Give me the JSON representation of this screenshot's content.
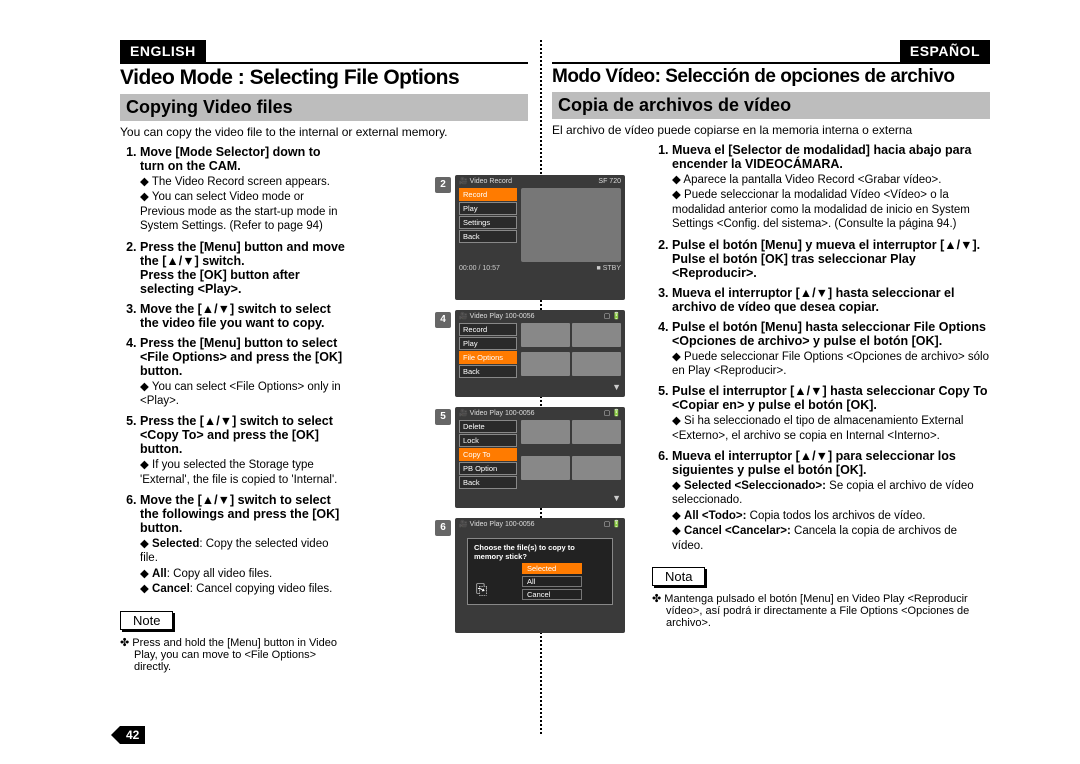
{
  "page_number": "42",
  "english": {
    "lang_label": "ENGLISH",
    "title": "Video Mode : Selecting File Options",
    "subtitle": "Copying Video files",
    "intro": "You can copy the video file to the internal or external memory.",
    "step1": "Move [Mode Selector] down to turn on the CAM.",
    "step1_d1": "The Video Record screen appears.",
    "step1_d2": "You can select Video mode or Previous mode as the start-up mode in System Settings. (Refer to page 94)",
    "step2": "Press the [Menu] button and move the [▲/▼] switch.",
    "step2b": "Press the [OK] button after selecting <Play>.",
    "step3": "Move the [▲/▼] switch to select the video file you want to copy.",
    "step4": "Press the [Menu] button to select <File Options> and press the [OK] button.",
    "step4_d1": "You can select <File Options> only in <Play>.",
    "step5": "Press the [▲/▼] switch to select <Copy To> and press the [OK] button.",
    "step5_d1": "If you selected the Storage type 'External', the file is copied to 'Internal'.",
    "step6": "Move the [▲/▼] switch to select the followings and press the [OK] button.",
    "step6_d1_label": "Selected",
    "step6_d1": ": Copy the selected video file.",
    "step6_d2_label": "All",
    "step6_d2": ": Copy all video files.",
    "step6_d3_label": "Cancel",
    "step6_d3": ": Cancel copying video files.",
    "note_label": "Note",
    "note_text": "Press and hold the [Menu] button in Video Play, you can move to <File Options> directly."
  },
  "espanol": {
    "lang_label": "ESPAÑOL",
    "title": "Modo Vídeo: Selección de opciones de archivo",
    "subtitle": "Copia de archivos de vídeo",
    "intro": "El archivo de vídeo puede copiarse en la memoria interna o externa",
    "step1": "Mueva el [Selector de modalidad] hacia abajo para encender la VIDEOCÁMARA.",
    "step1_d1": "Aparece la pantalla Video Record <Grabar vídeo>.",
    "step1_d2": "Puede seleccionar la modalidad Vídeo <Vídeo> o la modalidad anterior como la modalidad de inicio en System Settings <Config. del sistema>. (Consulte la página 94.)",
    "step2": "Pulse el botón [Menu] y mueva el interruptor [▲/▼]. Pulse el botón [OK] tras seleccionar Play <Reproducir>.",
    "step3": "Mueva el interruptor [▲/▼] hasta seleccionar el archivo de vídeo que desea copiar.",
    "step4": "Pulse el botón [Menu] hasta seleccionar File Options <Opciones de archivo> y pulse el botón [OK].",
    "step4_d1": "Puede seleccionar File Options <Opciones de archivo> sólo en Play <Reproducir>.",
    "step5": "Pulse el interruptor [▲/▼] hasta seleccionar Copy To <Copiar en> y pulse el botón [OK].",
    "step5_d1": "Si ha seleccionado el tipo de almacenamiento External <Externo>, el archivo se copia en Internal <Interno>.",
    "step6": "Mueva el interruptor [▲/▼] para seleccionar los siguientes y pulse el botón [OK].",
    "step6_d1_label": "Selected <Seleccionado>:",
    "step6_d1": " Se copia el archivo de vídeo seleccionado.",
    "step6_d2_label": "All <Todo>:",
    "step6_d2": " Copia todos los archivos de vídeo.",
    "step6_d3_label": "Cancel <Cancelar>:",
    "step6_d3": " Cancela la copia de archivos de vídeo.",
    "note_label": "Nota",
    "note_text": "Mantenga pulsado el botón [Menu] en Video Play <Reproducir vídeo>, así podrá ir directamente a File Options <Opciones de archivo>."
  },
  "screens": {
    "s2_title": "Video Record",
    "s2_badges": "SF  720",
    "s2_menu": [
      "Record",
      "Play",
      "Settings",
      "Back"
    ],
    "s2_time": "00:00 / 10:57",
    "s2_stby": "STBY",
    "s4_title": "Video Play  100-0056",
    "s4_menu": [
      "Record",
      "Play",
      "File Options",
      "Back"
    ],
    "s5_title": "Video Play  100-0056",
    "s5_menu": [
      "Delete",
      "Lock",
      "Copy To",
      "PB Option",
      "Back"
    ],
    "s6_title": "Video Play  100-0056",
    "s6_popup_q": "Choose the file(s) to copy to memory stick?",
    "s6_opts": [
      "Selected",
      "All",
      "Cancel"
    ]
  }
}
